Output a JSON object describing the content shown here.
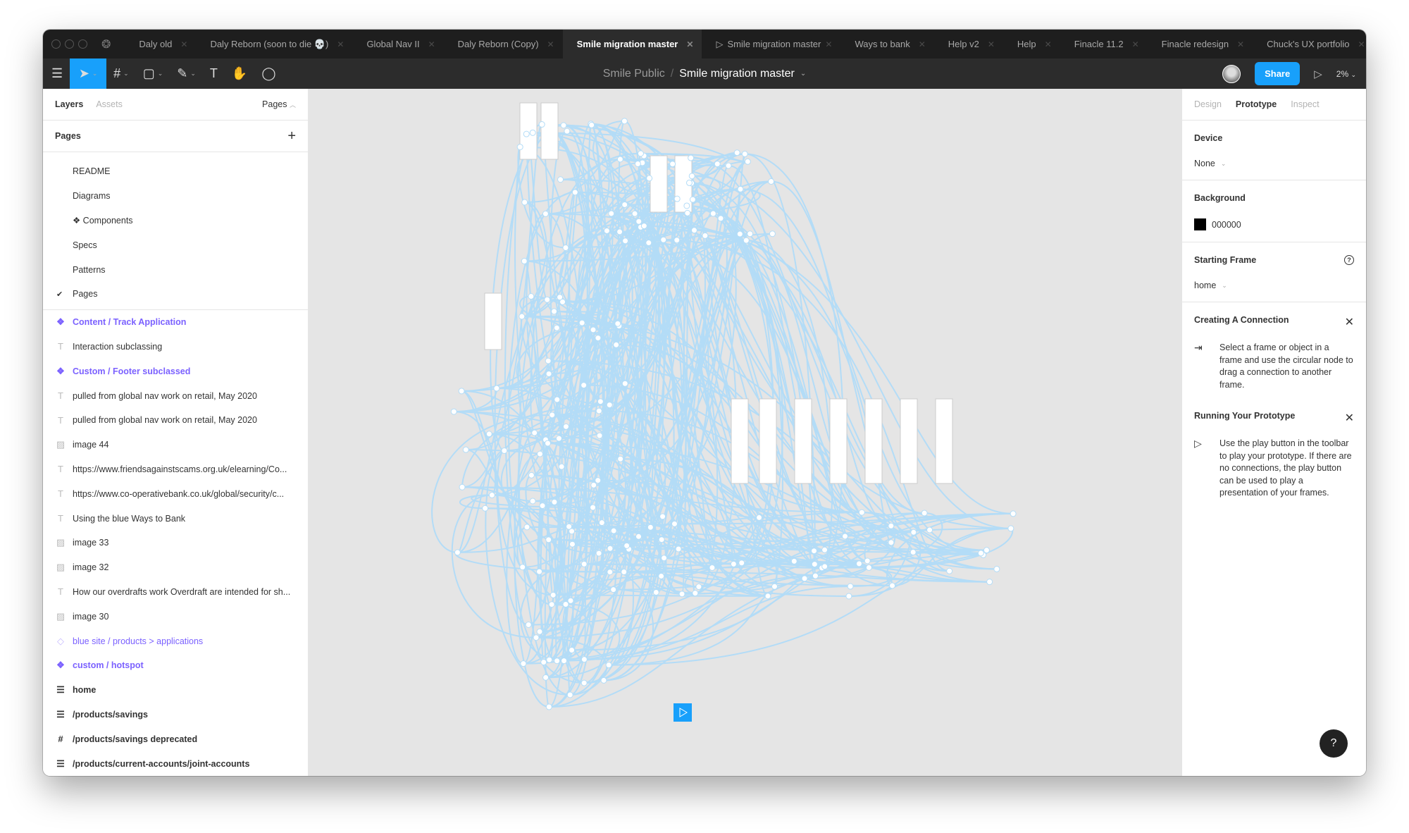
{
  "tabs": [
    {
      "label": "Daly old"
    },
    {
      "label": "Daly Reborn (soon to die 💀)"
    },
    {
      "label": "Global Nav II"
    },
    {
      "label": "Daly Reborn (Copy)"
    },
    {
      "label": "Smile migration master",
      "active": true
    },
    {
      "label": "Smile migration master",
      "prototype": true
    },
    {
      "label": "Ways to bank"
    },
    {
      "label": "Help v2"
    },
    {
      "label": "Help"
    },
    {
      "label": "Finacle 11.2"
    },
    {
      "label": "Finacle redesign"
    },
    {
      "label": "Chuck's UX portfolio"
    }
  ],
  "toolbar": {
    "project": "Smile Public",
    "separator": "/",
    "file": "Smile migration master",
    "share": "Share",
    "zoom": "2%"
  },
  "left": {
    "tab_layers": "Layers",
    "tab_assets": "Assets",
    "pages_toggle": "Pages",
    "pages_title": "Pages",
    "pages": [
      {
        "label": "README"
      },
      {
        "label": "Diagrams"
      },
      {
        "label": "❖ Components"
      },
      {
        "label": "Specs"
      },
      {
        "label": "Patterns"
      },
      {
        "label": "Pages",
        "current": true
      }
    ],
    "layers": [
      {
        "label": "Content / Track Application",
        "type": "component"
      },
      {
        "label": "Interaction subclassing",
        "type": "text"
      },
      {
        "label": "Custom / Footer subclassed",
        "type": "component"
      },
      {
        "label": "pulled from global nav work on retail, May 2020",
        "type": "text"
      },
      {
        "label": "pulled from global nav work on retail, May 2020",
        "type": "text"
      },
      {
        "label": "image 44",
        "type": "image"
      },
      {
        "label": "https://www.friendsagainstscams.org.uk/elearning/Co...",
        "type": "text"
      },
      {
        "label": "https://www.co-operativebank.co.uk/global/security/c...",
        "type": "text"
      },
      {
        "label": "Using the blue Ways to Bank",
        "type": "text"
      },
      {
        "label": "image 33",
        "type": "image"
      },
      {
        "label": "image 32",
        "type": "image"
      },
      {
        "label": "How our overdrafts work Overdraft are intended for sh...",
        "type": "text"
      },
      {
        "label": "image 30",
        "type": "image"
      },
      {
        "label": "blue site / products > applications",
        "type": "instance"
      },
      {
        "label": "custom / hotspot",
        "type": "component"
      },
      {
        "label": "home",
        "type": "frame-stack"
      },
      {
        "label": "/products/savings",
        "type": "frame-stack"
      },
      {
        "label": "/products/savings deprecated",
        "type": "frame"
      },
      {
        "label": "/products/current-accounts/joint-accounts",
        "type": "frame-stack"
      }
    ]
  },
  "right": {
    "tabs": {
      "design": "Design",
      "prototype": "Prototype",
      "inspect": "Inspect"
    },
    "device_title": "Device",
    "device_value": "None",
    "background_title": "Background",
    "background_value": "000000",
    "starting_title": "Starting Frame",
    "starting_value": "home",
    "tip1_title": "Creating A Connection",
    "tip1_body": "Select a frame or object in a frame and use the circular node to drag a connection to another frame.",
    "tip2_title": "Running Your Prototype",
    "tip2_body": "Use the play button in the toolbar to play your prototype. If there are no connections, the play button can be used to play a presentation of your frames.",
    "help": "?"
  },
  "colors": {
    "accent": "#18a0fb",
    "component": "#7b61ff",
    "connection": "#b3dcf7",
    "canvas": "#e5e5e5"
  }
}
